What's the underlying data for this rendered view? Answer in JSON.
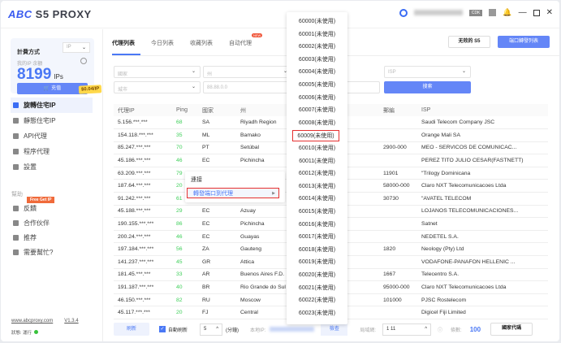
{
  "app": {
    "logo": "ABC",
    "title": "S5 PROXY",
    "cdk": "CDK"
  },
  "sidebar": {
    "billing_label": "計費方式",
    "billing_select": "IP",
    "balance_label": "我的IP 余額",
    "balance": "8199",
    "unit": "IPs",
    "recharge": "充值",
    "price": "$0.04/IP",
    "items": [
      {
        "label": "旋轉住宅IP",
        "active": true
      },
      {
        "label": "靜態住宅IP"
      },
      {
        "label": "API代理"
      },
      {
        "label": "程序代理"
      },
      {
        "label": "設置"
      }
    ],
    "help_label": "幫助",
    "free_badge": "Free Get IP",
    "help_items": [
      {
        "label": "反饋"
      },
      {
        "label": "合作伙伴"
      },
      {
        "label": "推荐"
      },
      {
        "label": "需要幫忙?"
      }
    ],
    "website": "www.abcproxy.com",
    "version": "V1.3.4",
    "status": "狀態: 運行"
  },
  "tabs": [
    {
      "label": "代理列表",
      "active": true
    },
    {
      "label": "今日列表"
    },
    {
      "label": "收藏列表"
    },
    {
      "label": "自动代理",
      "badge": "NEW"
    }
  ],
  "buttons": {
    "invalid_s5": "无效的 S5",
    "port_list": "端口轉發列表",
    "search": "搜索"
  },
  "filters": {
    "country": "國家",
    "state": "州",
    "city": "城市",
    "ip_placeholder": "88.88.0.0",
    "isp": "ISP"
  },
  "table": {
    "headers": [
      "代理IP",
      "Ping",
      "國家",
      "州",
      "",
      "郵編",
      "ISP"
    ],
    "rows": [
      [
        "5.156.***.***",
        "68",
        "SA",
        "Riyadh Region",
        "",
        "",
        "Saudi Telecom Company JSC"
      ],
      [
        "154.118.***.***",
        "35",
        "ML",
        "Bamako",
        "",
        "",
        "Orange Mali SA"
      ],
      [
        "85.247.***.***",
        "70",
        "PT",
        "Setúbal",
        "",
        "2900-000",
        "MEO - SERVICOS DE COMUNICAC..."
      ],
      [
        "45.186.***.***",
        "46",
        "EC",
        "Pichincha",
        "",
        "",
        "PEREZ TITO JULIO CESAR(FASTNETT)"
      ],
      [
        "63.209.***.***",
        "79",
        "",
        "",
        "",
        "11901",
        "\"Trilogy Dominicana"
      ],
      [
        "187.64.***.***",
        "20",
        "",
        "",
        "",
        "58000-000",
        "Claro NXT Telecomunicacoes Ltda"
      ],
      [
        "91.242.***.***",
        "61",
        "",
        "",
        "",
        "30730",
        "\"AVATEL TELECOM"
      ],
      [
        "45.188.***.***",
        "29",
        "EC",
        "Azuay",
        "",
        "",
        "LOJANOS TELECOMUNICACIONES..."
      ],
      [
        "190.155.***.***",
        "86",
        "EC",
        "Pichincha",
        "",
        "",
        "Satnet"
      ],
      [
        "200.24.***.***",
        "46",
        "EC",
        "Guayas",
        "",
        "",
        "NEDETEL S.A."
      ],
      [
        "197.184.***.***",
        "56",
        "ZA",
        "Gauteng",
        "",
        "1820",
        "Neology (Pty) Ltd"
      ],
      [
        "141.237.***.***",
        "45",
        "GR",
        "Attica",
        "",
        "",
        "VODAFONE-PANAFON HELLENIC ..."
      ],
      [
        "181.45.***.***",
        "33",
        "AR",
        "Buenos Aires F.D.",
        "",
        "1667",
        "Telecentro S.A."
      ],
      [
        "191.187.***.***",
        "40",
        "BR",
        "Rio Grande do Sul",
        "",
        "95000-000",
        "Claro NXT Telecomunicacoes Ltda"
      ],
      [
        "46.150.***.***",
        "82",
        "RU",
        "Moscow",
        "",
        "101000",
        "PJSC Rostelecom"
      ],
      [
        "45.117.***.***",
        "20",
        "FJ",
        "Central",
        "",
        "",
        "Digicel Fiji Limited"
      ]
    ]
  },
  "bottom": {
    "refresh": "刷新",
    "auto_refresh": "自動刷新",
    "interval": "5",
    "unit": "(分鐘)",
    "local_ip_label": "本地IP:",
    "check": "檢查",
    "port_range_label": "局域網:",
    "port_value": "1    11",
    "count_label": "條數:",
    "count": "100",
    "country_code": "國家代碼"
  },
  "context_menu": {
    "items": [
      "連接",
      "轉發端口到代理"
    ]
  },
  "ports": [
    "60000(未使用)",
    "60001(未使用)",
    "60002(未使用)",
    "60003(未使用)",
    "60004(未使用)",
    "60005(未使用)",
    "60006(未使用)",
    "60007(未使用)",
    "60008(未使用)",
    "60009(未使用)",
    "60010(未使用)",
    "60011(未使用)",
    "60012(未使用)",
    "60013(未使用)",
    "60014(未使用)",
    "60015(未使用)",
    "60016(未使用)",
    "60017(未使用)",
    "60018(未使用)",
    "60019(未使用)",
    "60020(未使用)",
    "60021(未使用)",
    "60022(未使用)",
    "60023(未使用)"
  ],
  "selected_port": "60009(未使用)"
}
